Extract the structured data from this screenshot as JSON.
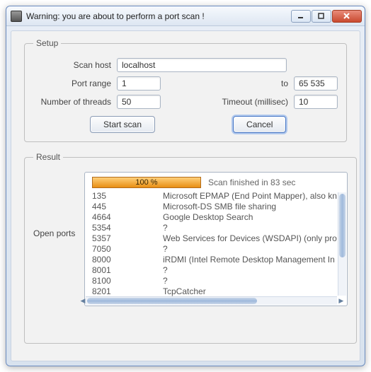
{
  "window": {
    "title": "Warning: you are about to perform a port scan !"
  },
  "setup": {
    "legend": "Setup",
    "host_label": "Scan host",
    "host_value": "localhost",
    "range_label": "Port range",
    "range_from": "1",
    "range_to_label": "to",
    "range_to": "65 535",
    "threads_label": "Number of threads",
    "threads_value": "50",
    "timeout_label": "Timeout (millisec)",
    "timeout_value": "10",
    "start_label": "Start scan",
    "cancel_label": "Cancel"
  },
  "result": {
    "legend": "Result",
    "open_ports_label": "Open ports",
    "progress_text": "100 %",
    "finished_text": "Scan finished in 83 sec",
    "ports": [
      {
        "port": "135",
        "service": "Microsoft EPMAP (End Point Mapper), also kn"
      },
      {
        "port": "445",
        "service": "Microsoft-DS SMB file sharing"
      },
      {
        "port": "4664",
        "service": "Google Desktop Search"
      },
      {
        "port": "5354",
        "service": "?"
      },
      {
        "port": "5357",
        "service": "Web Services for Devices (WSDAPI) (only pro"
      },
      {
        "port": "7050",
        "service": "?"
      },
      {
        "port": "8000",
        "service": "iRDMI (Intel Remote Desktop Management In"
      },
      {
        "port": "8001",
        "service": "?"
      },
      {
        "port": "8100",
        "service": "?"
      },
      {
        "port": "8201",
        "service": "TcpCatcher"
      }
    ]
  }
}
